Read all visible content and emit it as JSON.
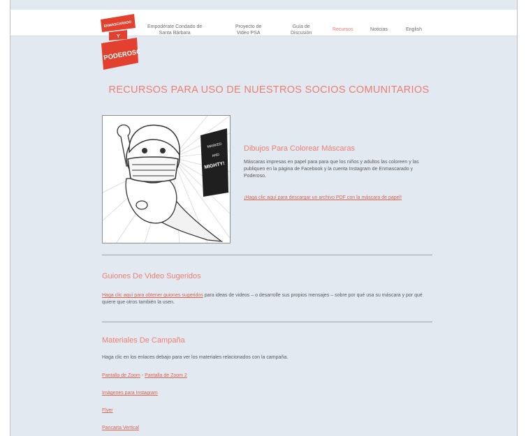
{
  "logo": {
    "line1": "ENMASCARADO",
    "line2": "Y",
    "line3": "PODEROSO!"
  },
  "nav": {
    "item1_line1": "Empodérate Condado de",
    "item1_line2": "Santa Bárbara",
    "item2_line1": "Proyecto de",
    "item2_line2": "Video PSA",
    "item3_line1": "Guía de",
    "item3_line2": "Discusión",
    "item4": "Recursos",
    "item5": "Noticias",
    "item6": "English",
    "active_color": "#ea7b6c"
  },
  "page": {
    "title": "RECURSOS PARA USO DE NUESTROS SOCIOS COMUNITARIOS"
  },
  "illustration": {
    "banner_word1": "MASKED",
    "banner_word2": "AND",
    "banner_word3": "MIGHTY!",
    "icon": "masked-superhero-coloring-page"
  },
  "coloring": {
    "heading": "Dibujos Para Colorear Máscaras",
    "description": "Máscaras impresas en papel para para que los niños y adultos las coloreen y las publiquen en la página de Facebook y la cuenta Instagram de Enmascarado y Poderoso.",
    "link": "¡Haga clic aquí para descargar un archivo PDF con la máscara de papel!"
  },
  "video": {
    "heading": "Guiones De Video Sugeridos",
    "link": "Haga clic aquí para obtener guiones sugeridos",
    "text": " para ideas de videos – o desarrolle sus propios mensajes – sobre por qué usa su máscara y por qué quiere que otros también la usen."
  },
  "campaign": {
    "heading": "Materiales De Campaña",
    "intro": "Haga clic en los enlaces debajo para ver los materiales relacionados con la campaña.",
    "link1": "Pantalla de Zoom",
    "separator": " - ",
    "link2": "Pantalla de Zoom 2",
    "link3": "Imágenes para Instagram",
    "link4": "Flyer",
    "link5": "Pancarta Vertical"
  },
  "colors": {
    "accent": "#ec7e70",
    "link": "#d9634f",
    "background": "#e3e9f1",
    "logo_red": "#e2412f"
  }
}
